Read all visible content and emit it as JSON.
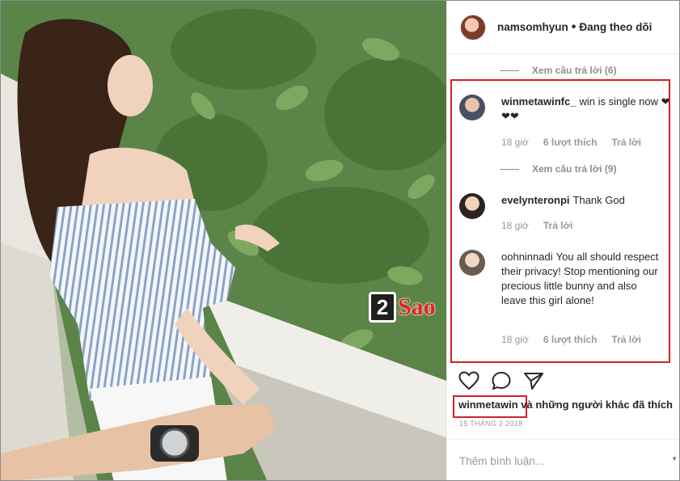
{
  "header": {
    "username": "namsomhyun",
    "separator": "•",
    "follow_status": "Đang theo dõi"
  },
  "replies_1": {
    "label": "Xem câu trả lời (6)"
  },
  "replies_2": {
    "label": "Xem câu trả lời (9)"
  },
  "comments": [
    {
      "username": "winmetawinfc_",
      "text": "win is single now ❤❤❤",
      "time": "18 giờ",
      "likes": "6 lượt thích",
      "reply": "Trả lời"
    },
    {
      "username": "evelynteronpi",
      "text": "Thank God",
      "time": "18 giờ",
      "reply": "Trả lời"
    },
    {
      "username": "oohninnadi",
      "text": "You all should respect their privacy! Stop mentioning our precious little bunny and also leave this girl alone!",
      "time": "18 giờ",
      "likes": "6 lượt thích",
      "reply": "Trả lời"
    }
  ],
  "likes_line": {
    "username": "winmetawin",
    "rest": " và những người khác đã thích"
  },
  "post_date": "15 THÁNG 2 2018",
  "add_comment_placeholder": "Thêm bình luận...",
  "watermark": {
    "badge": "2",
    "text": "Sao"
  },
  "colors": {
    "highlight_box": "#d32027",
    "muted_text": "#999999"
  },
  "icons": [
    "heart-icon",
    "comment-icon",
    "share-icon"
  ]
}
